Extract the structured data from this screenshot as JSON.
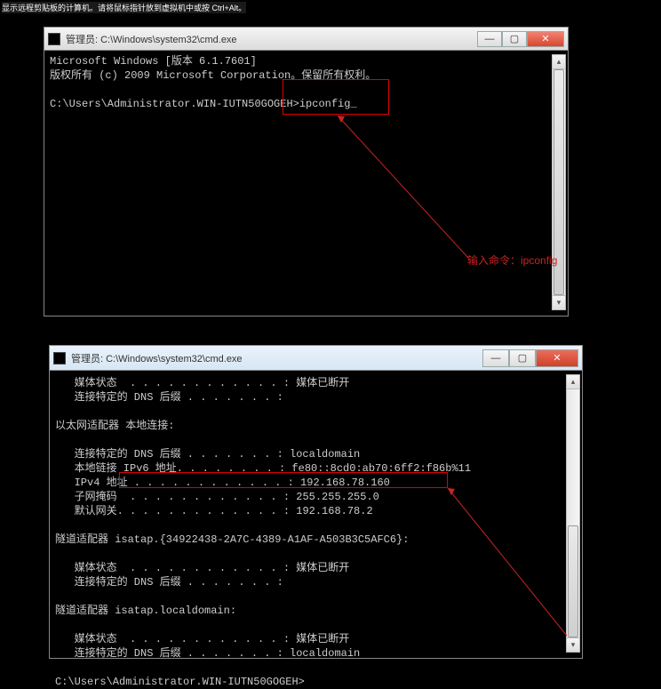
{
  "top_hint": "显示远程剪贴板的计算机。请将鼠标指针放到虚拟机中或按 Ctrl+Alt。",
  "window1": {
    "title": "管理员: C:\\Windows\\system32\\cmd.exe",
    "lines": {
      "l1": "Microsoft Windows [版本 6.1.7601]",
      "l2": "版权所有 (c) 2009 Microsoft Corporation。保留所有权利。",
      "l3": "",
      "l4": "C:\\Users\\Administrator.WIN-IUTN50GOGEH>ipconfig_"
    }
  },
  "annotation1": "输入命令：ipconfig",
  "window2": {
    "title": "管理员: C:\\Windows\\system32\\cmd.exe",
    "lines": {
      "l1": "   媒体状态  . . . . . . . . . . . . : 媒体已断开",
      "l2": "   连接特定的 DNS 后缀 . . . . . . . :",
      "l3": "",
      "l4": "以太网适配器 本地连接:",
      "l5": "",
      "l6": "   连接特定的 DNS 后缀 . . . . . . . : localdomain",
      "l7": "   本地链接 IPv6 地址. . . . . . . . : fe80::8cd0:ab70:6ff2:f86b%11",
      "l8": "   IPv4 地址 . . . . . . . . . . . . : 192.168.78.160",
      "l9": "   子网掩码  . . . . . . . . . . . . : 255.255.255.0",
      "l10": "   默认网关. . . . . . . . . . . . . : 192.168.78.2",
      "l11": "",
      "l12": "隧道适配器 isatap.{34922438-2A7C-4389-A1AF-A503B3C5AFC6}:",
      "l13": "",
      "l14": "   媒体状态  . . . . . . . . . . . . : 媒体已断开",
      "l15": "   连接特定的 DNS 后缀 . . . . . . . :",
      "l16": "",
      "l17": "隧道适配器 isatap.localdomain:",
      "l18": "",
      "l19": "   媒体状态  . . . . . . . . . . . . : 媒体已断开",
      "l20": "   连接特定的 DNS 后缀 . . . . . . . : localdomain",
      "l21": "",
      "l22": "C:\\Users\\Administrator.WIN-IUTN50GOGEH>"
    }
  },
  "buttons": {
    "min": "—",
    "max": "▢",
    "close": "✕"
  },
  "arrows": {
    "up": "▴",
    "down": "▾"
  }
}
